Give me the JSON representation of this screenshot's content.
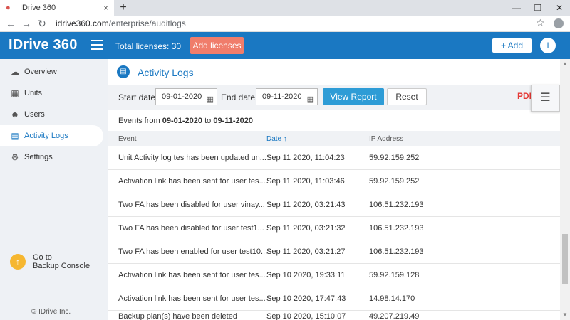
{
  "browser": {
    "tab_title": "IDrive 360",
    "tab_close": "×",
    "new_tab": "+",
    "url_host": "idrive360.com",
    "url_path": "/enterprise/auditlogs",
    "profile_initial": ""
  },
  "header": {
    "logo": "IDrive 360",
    "total_licenses": "Total licenses: 30",
    "add_licenses": "Add licenses",
    "add_button": "+ Add",
    "user_initial": "I"
  },
  "sidebar": {
    "items": [
      {
        "label": "Overview",
        "icon": "cloud-icon"
      },
      {
        "label": "Units",
        "icon": "units-icon"
      },
      {
        "label": "Users",
        "icon": "user-icon"
      },
      {
        "label": "Activity Logs",
        "icon": "activity-log-icon"
      },
      {
        "label": "Settings",
        "icon": "gear-icon"
      }
    ],
    "active": "Activity Logs",
    "backup_line1": "Go to",
    "backup_line2": "Backup Console",
    "copyright": "© IDrive Inc."
  },
  "page": {
    "title": "Activity Logs",
    "start_label": "Start date",
    "start_value": "09-01-2020",
    "end_label": "End date",
    "end_value": "09-11-2020",
    "view_report": "View Report",
    "reset": "Reset",
    "pdf_label": "PDF",
    "events_prefix": "Events from",
    "events_from": "09-01-2020",
    "events_to_word": "to",
    "events_to": "09-11-2020"
  },
  "table": {
    "columns": [
      "Event",
      "Date ↑",
      "IP Address"
    ],
    "rows": [
      {
        "event": "Unit Activity log tes has been updated un...",
        "date": "Sep 11 2020, 11:04:23",
        "ip": "59.92.159.252"
      },
      {
        "event": "Activation link has been sent for user tes...",
        "date": "Sep 11 2020, 11:03:46",
        "ip": "59.92.159.252"
      },
      {
        "event": "Two FA has been disabled for user vinay...",
        "date": "Sep 11 2020, 03:21:43",
        "ip": "106.51.232.193"
      },
      {
        "event": "Two FA has been disabled for user test1...",
        "date": "Sep 11 2020, 03:21:32",
        "ip": "106.51.232.193"
      },
      {
        "event": "Two FA has been enabled for user test10...",
        "date": "Sep 11 2020, 03:21:27",
        "ip": "106.51.232.193"
      },
      {
        "event": "Activation link has been sent for user tes...",
        "date": "Sep 10 2020, 19:33:11",
        "ip": "59.92.159.128"
      },
      {
        "event": "Activation link has been sent for user tes...",
        "date": "Sep 10 2020, 17:47:43",
        "ip": "14.98.14.170"
      },
      {
        "event": "Backup plan(s) have been deleted",
        "date": "Sep 10 2020, 15:10:07",
        "ip": "49.207.219.49"
      }
    ]
  },
  "colors": {
    "brand": "#1a78c2",
    "accent": "#f07d6b",
    "button": "#2e9cd6"
  }
}
